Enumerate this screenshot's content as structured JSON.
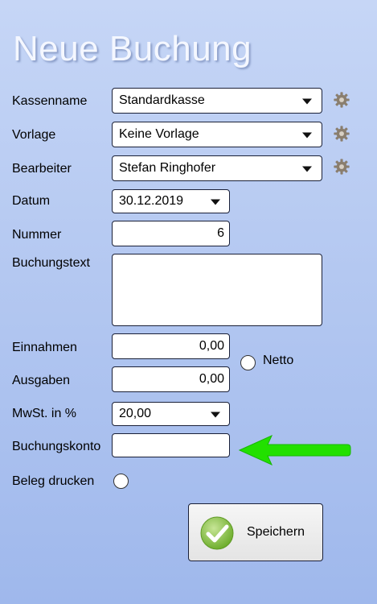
{
  "title": "Neue Buchung",
  "accent_colors": {
    "arrow": "#22e000",
    "check": "#8cc63f",
    "gear": "#8a7e6e"
  },
  "fields": {
    "kassenname": {
      "label": "Kassenname",
      "value": "Standardkasse"
    },
    "vorlage": {
      "label": "Vorlage",
      "value": "Keine Vorlage"
    },
    "bearbeiter": {
      "label": "Bearbeiter",
      "value": "Stefan Ringhofer"
    },
    "datum": {
      "label": "Datum",
      "value": "30.12.2019"
    },
    "nummer": {
      "label": "Nummer",
      "value": "6"
    },
    "buchungstext": {
      "label": "Buchungstext",
      "value": ""
    },
    "einnahmen": {
      "label": "Einnahmen",
      "value": "0,00"
    },
    "ausgaben": {
      "label": "Ausgaben",
      "value": "0,00"
    },
    "netto": {
      "label": "Netto",
      "checked": false
    },
    "mwst": {
      "label": "MwSt. in %",
      "value": "20,00"
    },
    "buchungskonto": {
      "label": "Buchungskonto",
      "value": ""
    },
    "beleg_drucken": {
      "label": "Beleg drucken",
      "checked": false
    }
  },
  "buttons": {
    "save_label": "Speichern"
  },
  "icons": {
    "settings": "gear-icon",
    "save": "checkmark-icon",
    "pointer": "arrow-left-icon"
  }
}
